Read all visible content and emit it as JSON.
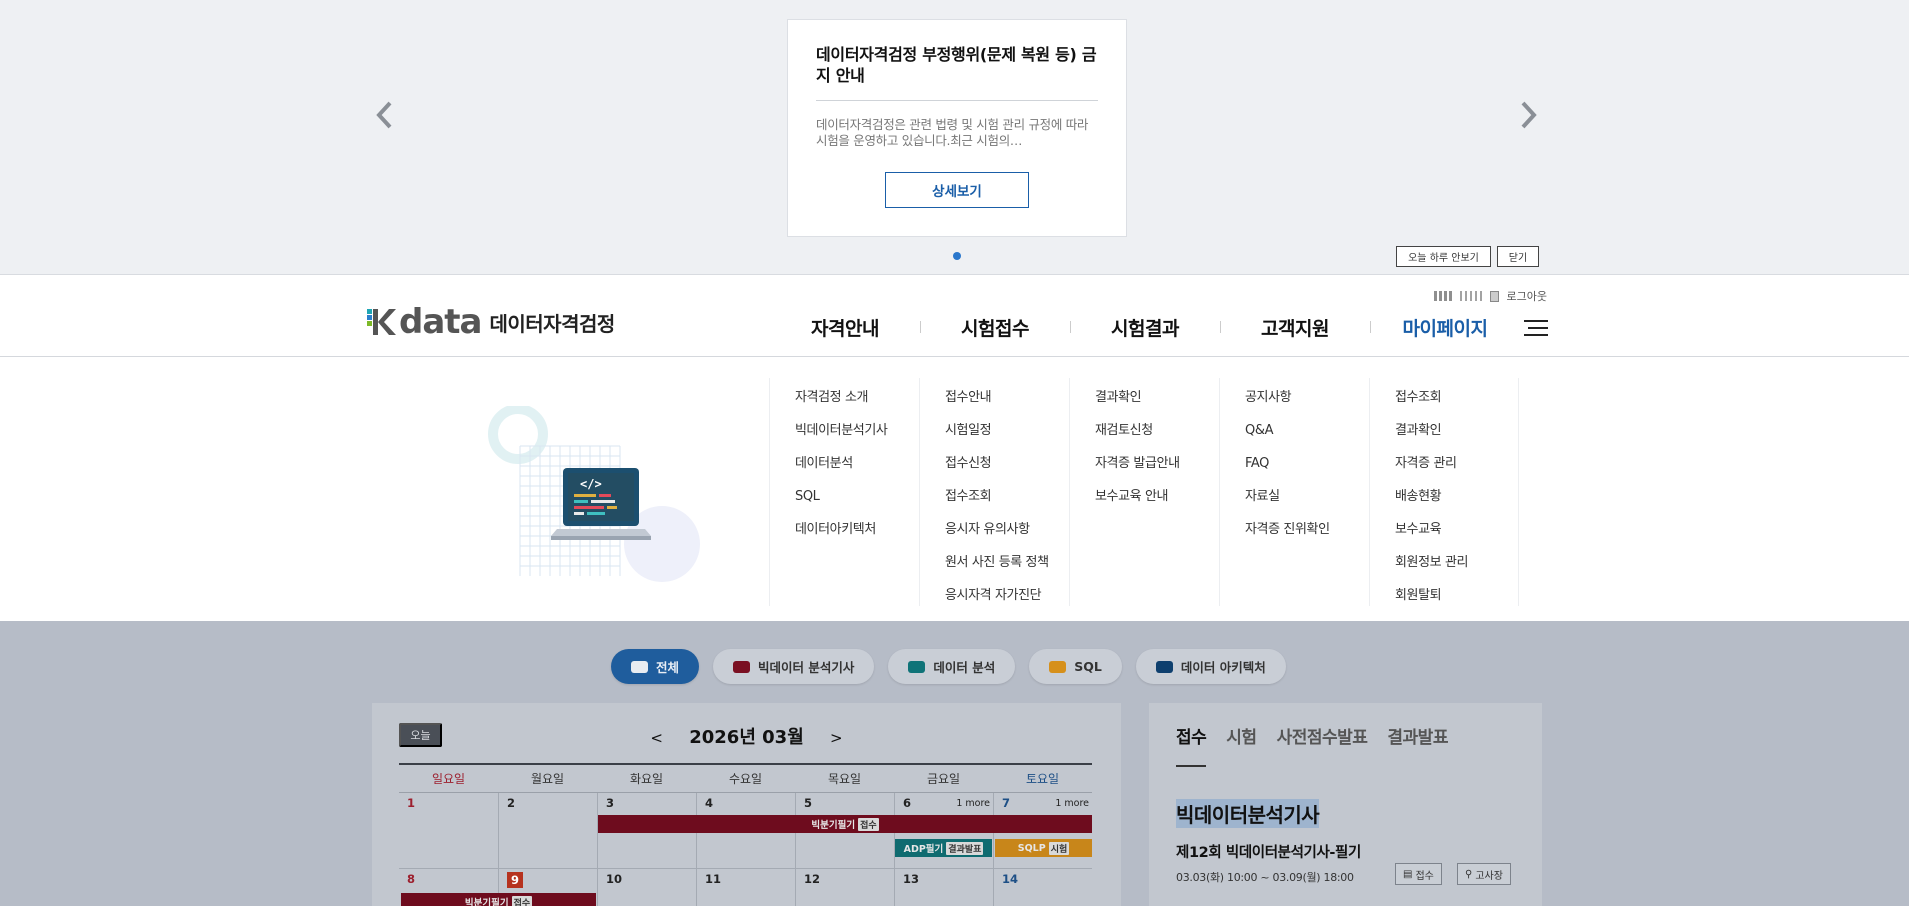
{
  "popup": {
    "title": "데이터자격검정 부정행위(문제 복원 등) 금지 안내",
    "body": "데이터자격검정은 관련 법령 및 시험 관리 규정에 따라 시험을 운영하고 있습니다.최근 시험의…",
    "detail_button": "상세보기",
    "today_close": "오늘 하루 안보기",
    "close": "닫기"
  },
  "header": {
    "logo_word": "data",
    "logo_name": "데이터자격검정",
    "logout": "로그아웃",
    "gnb": [
      "자격안내",
      "시험접수",
      "시험결과",
      "고객지원",
      "마이페이지"
    ]
  },
  "mega_menu": [
    [
      "자격검정 소개",
      "빅데이터분석기사",
      "데이터분석",
      "SQL",
      "데이터아키텍처"
    ],
    [
      "접수안내",
      "시험일정",
      "접수신청",
      "접수조회",
      "응시자 유의사항",
      "원서 사진 등록 정책",
      "응시자격 자가진단"
    ],
    [
      "결과확인",
      "재검토신청",
      "자격증 발급안내",
      "보수교육 안내"
    ],
    [
      "공지사항",
      "Q&A",
      "FAQ",
      "자료실",
      "자격증 진위확인"
    ],
    [
      "접수조회",
      "결과확인",
      "자격증 관리",
      "배송현황",
      "보수교육",
      "회원정보 관리",
      "회원탈퇴"
    ]
  ],
  "filters": [
    {
      "label": "전체",
      "color": "#e8ecf1"
    },
    {
      "label": "빅데이터 분석기사",
      "color": "#7a0f22"
    },
    {
      "label": "데이터 분석",
      "color": "#0f7378"
    },
    {
      "label": "SQL",
      "color": "#d6901b"
    },
    {
      "label": "데이터 아키텍처",
      "color": "#0e3f6e"
    }
  ],
  "calendar": {
    "today_button": "오늘",
    "prev": "<",
    "next": ">",
    "month_label": "2026년 03월",
    "weekdays": [
      "일요일",
      "월요일",
      "화요일",
      "수요일",
      "목요일",
      "금요일",
      "토요일"
    ],
    "week1": [
      "1",
      "2",
      "3",
      "4",
      "5",
      "6",
      "7"
    ],
    "week2": [
      "8",
      "9",
      "10",
      "11",
      "12",
      "13",
      "14"
    ],
    "more_label": "1 more",
    "events": {
      "bigdata_written": "빅분기필기",
      "apply_tag": "접수",
      "adp_written": "ADP필기",
      "result_tag": "결과발표",
      "sqlp": "SQLP",
      "exam_tag": "시험"
    }
  },
  "info": {
    "tabs": [
      "접수",
      "시험",
      "사전점수발표",
      "결과발표"
    ],
    "title": "빅데이터분석기사",
    "subtitle": "제12회 빅데이터분석기사-필기",
    "date": "03.03(화) 10:00 ~ 03.09(월) 18:00",
    "btn_apply": "접수",
    "btn_site": "고사장"
  }
}
